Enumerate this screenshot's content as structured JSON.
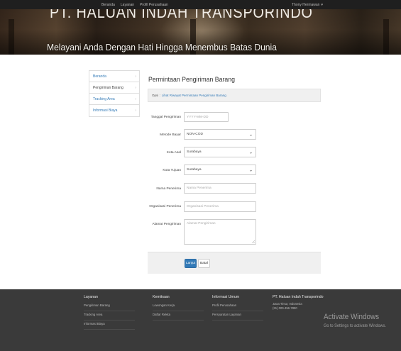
{
  "navbar": {
    "links": [
      "Beranda",
      "Layanan",
      "Profil Perusahaan"
    ],
    "user": "Thony Hermawan",
    "user_caret": "▾"
  },
  "hero": {
    "title": "PT. HALUAN INDAH TRANSPORINDO",
    "tagline": "Melayani Anda Dengan Hati Hingga Menembus Batas Dunia"
  },
  "sidebar": {
    "items": [
      {
        "label": "Beranda",
        "style": "link"
      },
      {
        "label": "Pengiriman Barang",
        "style": "plain"
      },
      {
        "label": "Tracking Area",
        "style": "link"
      },
      {
        "label": "Informasi Biaya",
        "style": "link"
      }
    ],
    "chevron": "›"
  },
  "main": {
    "title": "Permintaan Pengiriman Barang",
    "info_label": "Opsi :",
    "info_link": "Lihat Riwayat Permintaan Pengiriman Barang"
  },
  "form": {
    "tanggal": {
      "label": "Tanggal Pengiriman",
      "placeholder": "YYYY-MM-DD"
    },
    "metode": {
      "label": "Metode Bayar",
      "value": "NON-COD"
    },
    "kota_asal": {
      "label": "Kota Asal",
      "value": "Surabaya"
    },
    "kota_tujuan": {
      "label": "Kota Tujuan",
      "value": "Surabaya"
    },
    "nama": {
      "label": "Nama Penerima",
      "placeholder": "Nama Penerima"
    },
    "organisasi": {
      "label": "Organisasi Penerima",
      "placeholder": "Organisasi Penerima"
    },
    "alamat": {
      "label": "Alamat Pengiriman",
      "placeholder": "Alamat Pengiriman"
    },
    "caret": "⌄"
  },
  "actions": {
    "submit": "Lanjut",
    "cancel": "Batal"
  },
  "footer": {
    "columns": [
      {
        "heading": "Layanan",
        "items": [
          "Pengiriman Barang",
          "Tracking Area",
          "Informasi Biaya"
        ]
      },
      {
        "heading": "Kemitraan",
        "items": [
          "Lowongan Kerja",
          "Daftar Rekka"
        ]
      },
      {
        "heading": "Informasi Umum",
        "items": [
          "Profil Perusahaan",
          "Persyaratan Layanan"
        ]
      }
    ],
    "company": {
      "heading": "PT. Haluan Indah Transporindo",
      "lines": [
        "Jawa Timur, Indonesia",
        "(31) 000-456-7890"
      ]
    }
  },
  "watermark": {
    "title": "Activate Windows",
    "subtitle": "Go to Settings to activate Windows."
  },
  "colors": {
    "accent": "#337ab7",
    "navbar": "#1f1f1f",
    "footer": "#3a3a3a"
  }
}
